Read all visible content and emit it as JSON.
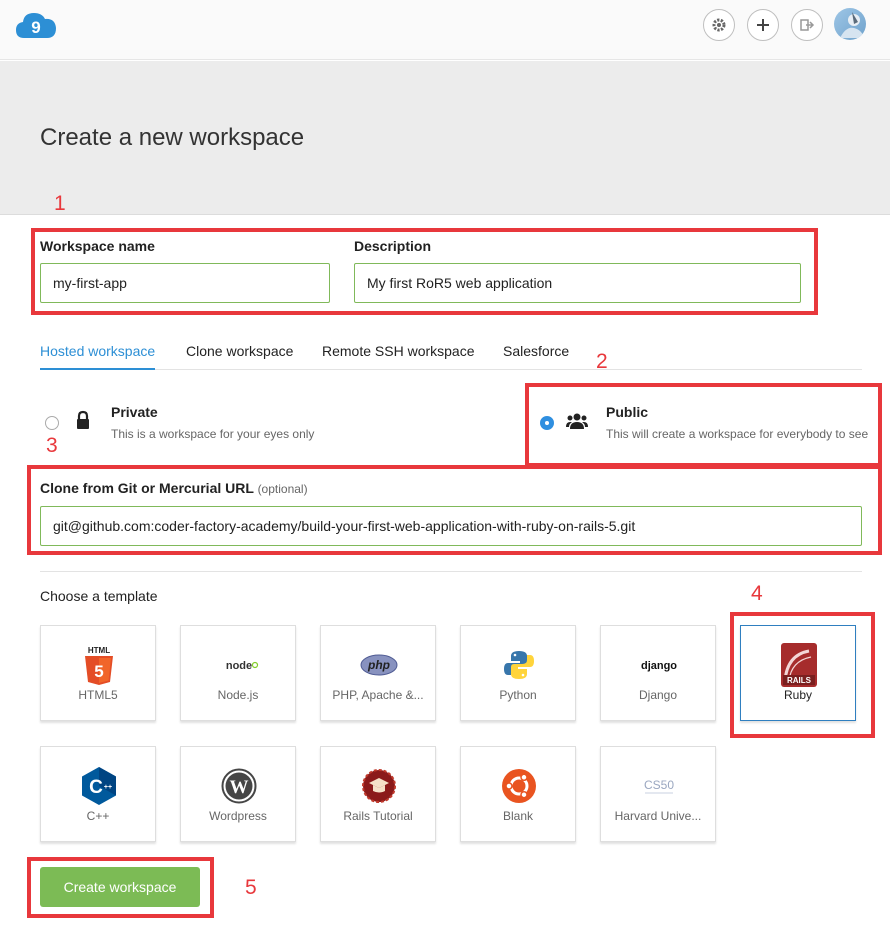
{
  "hero": {
    "title": "Create a new workspace"
  },
  "annotations": [
    "1",
    "2",
    "3",
    "4",
    "5"
  ],
  "form": {
    "name_label": "Workspace name",
    "name_value": "my-first-app",
    "desc_label": "Description",
    "desc_value": "My first RoR5 web application"
  },
  "tabs": [
    {
      "label": "Hosted workspace",
      "active": true
    },
    {
      "label": "Clone workspace"
    },
    {
      "label": "Remote SSH workspace"
    },
    {
      "label": "Salesforce"
    }
  ],
  "visibility": {
    "private": {
      "title": "Private",
      "desc": "This is a workspace for your eyes only",
      "icon": "lock-icon",
      "selected": false
    },
    "public": {
      "title": "Public",
      "desc": "This will create a workspace for everybody to see",
      "icon": "users-icon",
      "selected": true
    }
  },
  "clone": {
    "label": "Clone from Git or Mercurial URL",
    "optional": "(optional)",
    "value": "git@github.com:coder-factory-academy/build-your-first-web-application-with-ruby-on-rails-5.git"
  },
  "templates": {
    "title": "Choose a template",
    "items": [
      {
        "name": "HTML5",
        "icon": "html5-icon"
      },
      {
        "name": "Node.js",
        "icon": "nodejs-icon",
        "logo_text": "node"
      },
      {
        "name": "PHP, Apache &...",
        "icon": "php-icon",
        "logo_text": "php"
      },
      {
        "name": "Python",
        "icon": "python-icon"
      },
      {
        "name": "Django",
        "icon": "django-icon",
        "logo_text": "django"
      },
      {
        "name": "Ruby",
        "icon": "rails-icon",
        "logo_text": "RAILS",
        "selected": true
      },
      {
        "name": "C++",
        "icon": "cpp-icon"
      },
      {
        "name": "Wordpress",
        "icon": "wordpress-icon"
      },
      {
        "name": "Rails Tutorial",
        "icon": "rails-tutorial-icon"
      },
      {
        "name": "Blank",
        "icon": "ubuntu-icon"
      },
      {
        "name": "Harvard Unive...",
        "icon": "cs50-icon",
        "logo_text": "CS50"
      }
    ]
  },
  "actions": {
    "create_label": "Create workspace"
  },
  "colors": {
    "accent": "#2d8fd5",
    "create": "#7cbb55",
    "annotation": "#e8383c",
    "input_border": "#80b95a"
  }
}
